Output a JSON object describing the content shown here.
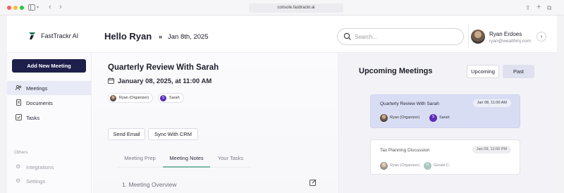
{
  "browser": {
    "url": "console.fasttrackr.ai",
    "colors": {
      "close": "#ff5f57",
      "minimize": "#febc2e",
      "maximize": "#28c840"
    }
  },
  "header": {
    "brand": "FastTrackr AI",
    "greeting": "Hello Ryan",
    "date": "Jan 8th, 2025",
    "search_placeholder": "Search...",
    "user": {
      "name": "Ryan Erdoes",
      "email": "ryan@wealthmj.com"
    }
  },
  "sidebar": {
    "new_button": "Add New Meeting",
    "items": [
      {
        "label": "Meetings",
        "icon": "person-icon"
      },
      {
        "label": "Documents",
        "icon": "document-icon"
      },
      {
        "label": "Tasks",
        "icon": "tasks-icon"
      }
    ],
    "others_heading": "Others",
    "others": [
      {
        "label": "Integrations",
        "icon": "integrations-icon"
      },
      {
        "label": "Settings",
        "icon": "settings-icon"
      }
    ]
  },
  "meeting": {
    "title": "Quarterly Review With Sarah",
    "datetime": "January 08, 2025, at 11:00 AM",
    "participants": [
      {
        "name": "Ryan (Organizer)"
      },
      {
        "name": "Sarah",
        "initial": "S"
      }
    ],
    "actions": {
      "send_email": "Send Email",
      "sync_crm": "Sync With CRM"
    },
    "tabs": [
      "Meeting Prep",
      "Meeting Notes",
      "Your Tasks"
    ],
    "active_tab": "Meeting Notes",
    "section_title": "1. Meeting Overview"
  },
  "upcoming": {
    "title": "Upcoming Meetings",
    "toggle": {
      "upcoming": "Upcoming",
      "past": "Past"
    },
    "cards": [
      {
        "title": "Quarterly Review With Sarah",
        "time": "Jan 08, 11:00 AM",
        "participants": [
          {
            "name": "Ryan (Organizer)"
          },
          {
            "name": "Sarah",
            "initial": "S"
          }
        ]
      },
      {
        "title": "Tax Planning Discussion",
        "time": "Jan 09, 12:00 PM",
        "participants": [
          {
            "name": "Ryan (Organizer)"
          },
          {
            "name": "Gerald C.",
            "initial": "G"
          }
        ]
      }
    ]
  },
  "colors": {
    "primary": "#1e1f4b",
    "accent_tab": "#7fb9a8",
    "selected_card": "#d9ddf3",
    "sarah_avatar": "#5b2bb8"
  }
}
